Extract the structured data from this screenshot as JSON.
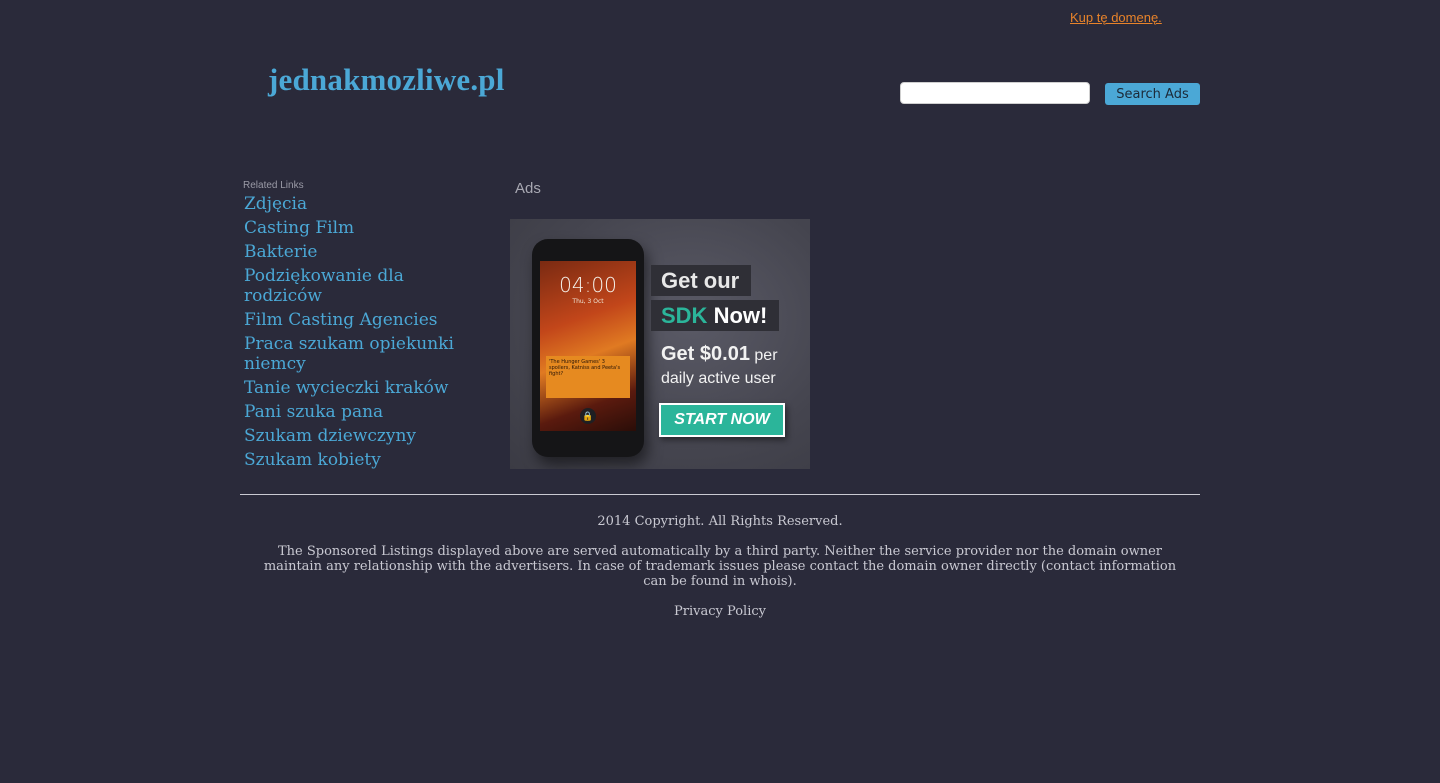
{
  "top": {
    "buy_domain_link": "Kup tę domenę."
  },
  "header": {
    "site_title": "jednakmozliwe.pl",
    "search_placeholder": "",
    "search_button_label": "Search Ads"
  },
  "sidebar": {
    "header": "Related Links",
    "links": [
      "Zdjęcia",
      "Casting Film",
      "Bakterie",
      "Podziękowanie dla rodziców",
      "Film Casting Agencies",
      "Praca szukam opiekunki niemcy",
      "Tanie wycieczki kraków",
      "Pani szuka pana",
      "Szukam dziewczyny",
      "Szukam kobiety"
    ]
  },
  "ads": {
    "label": "Ads",
    "banner": {
      "phone_time": "04:00",
      "phone_date": "Thu, 3 Oct",
      "phone_card_text": "'The Hunger Games' 3 spoilers, Katniss and Peeta's fight?",
      "headline_line1": "Get our",
      "headline_sdk": "SDK",
      "headline_now": "Now!",
      "offer_amount": "Get $0.01",
      "offer_per": "per",
      "offer_rest": "daily active user",
      "cta_label": "START NOW"
    }
  },
  "footer": {
    "copyright": "2014 Copyright. All Rights Reserved.",
    "disclaimer": "The Sponsored Listings displayed above are served automatically by a third party. Neither the service provider nor the domain owner maintain any relationship with the advertisers. In case of trademark issues please contact the domain owner directly (contact information can be found in whois).",
    "privacy_link": "Privacy Policy"
  },
  "colors": {
    "background": "#2a2a3a",
    "accent": "#4ba8d6",
    "buy_link": "#e8832a",
    "cta": "#2bb59a"
  }
}
